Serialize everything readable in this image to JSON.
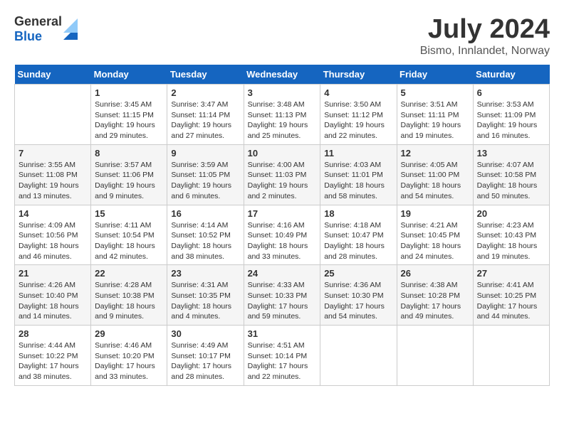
{
  "header": {
    "logo_general": "General",
    "logo_blue": "Blue",
    "month_year": "July 2024",
    "location": "Bismo, Innlandet, Norway"
  },
  "days_of_week": [
    "Sunday",
    "Monday",
    "Tuesday",
    "Wednesday",
    "Thursday",
    "Friday",
    "Saturday"
  ],
  "weeks": [
    [
      {
        "day": "",
        "sunrise": "",
        "sunset": "",
        "daylight": ""
      },
      {
        "day": "1",
        "sunrise": "Sunrise: 3:45 AM",
        "sunset": "Sunset: 11:15 PM",
        "daylight": "Daylight: 19 hours and 29 minutes."
      },
      {
        "day": "2",
        "sunrise": "Sunrise: 3:47 AM",
        "sunset": "Sunset: 11:14 PM",
        "daylight": "Daylight: 19 hours and 27 minutes."
      },
      {
        "day": "3",
        "sunrise": "Sunrise: 3:48 AM",
        "sunset": "Sunset: 11:13 PM",
        "daylight": "Daylight: 19 hours and 25 minutes."
      },
      {
        "day": "4",
        "sunrise": "Sunrise: 3:50 AM",
        "sunset": "Sunset: 11:12 PM",
        "daylight": "Daylight: 19 hours and 22 minutes."
      },
      {
        "day": "5",
        "sunrise": "Sunrise: 3:51 AM",
        "sunset": "Sunset: 11:11 PM",
        "daylight": "Daylight: 19 hours and 19 minutes."
      },
      {
        "day": "6",
        "sunrise": "Sunrise: 3:53 AM",
        "sunset": "Sunset: 11:09 PM",
        "daylight": "Daylight: 19 hours and 16 minutes."
      }
    ],
    [
      {
        "day": "7",
        "sunrise": "Sunrise: 3:55 AM",
        "sunset": "Sunset: 11:08 PM",
        "daylight": "Daylight: 19 hours and 13 minutes."
      },
      {
        "day": "8",
        "sunrise": "Sunrise: 3:57 AM",
        "sunset": "Sunset: 11:06 PM",
        "daylight": "Daylight: 19 hours and 9 minutes."
      },
      {
        "day": "9",
        "sunrise": "Sunrise: 3:59 AM",
        "sunset": "Sunset: 11:05 PM",
        "daylight": "Daylight: 19 hours and 6 minutes."
      },
      {
        "day": "10",
        "sunrise": "Sunrise: 4:00 AM",
        "sunset": "Sunset: 11:03 PM",
        "daylight": "Daylight: 19 hours and 2 minutes."
      },
      {
        "day": "11",
        "sunrise": "Sunrise: 4:03 AM",
        "sunset": "Sunset: 11:01 PM",
        "daylight": "Daylight: 18 hours and 58 minutes."
      },
      {
        "day": "12",
        "sunrise": "Sunrise: 4:05 AM",
        "sunset": "Sunset: 11:00 PM",
        "daylight": "Daylight: 18 hours and 54 minutes."
      },
      {
        "day": "13",
        "sunrise": "Sunrise: 4:07 AM",
        "sunset": "Sunset: 10:58 PM",
        "daylight": "Daylight: 18 hours and 50 minutes."
      }
    ],
    [
      {
        "day": "14",
        "sunrise": "Sunrise: 4:09 AM",
        "sunset": "Sunset: 10:56 PM",
        "daylight": "Daylight: 18 hours and 46 minutes."
      },
      {
        "day": "15",
        "sunrise": "Sunrise: 4:11 AM",
        "sunset": "Sunset: 10:54 PM",
        "daylight": "Daylight: 18 hours and 42 minutes."
      },
      {
        "day": "16",
        "sunrise": "Sunrise: 4:14 AM",
        "sunset": "Sunset: 10:52 PM",
        "daylight": "Daylight: 18 hours and 38 minutes."
      },
      {
        "day": "17",
        "sunrise": "Sunrise: 4:16 AM",
        "sunset": "Sunset: 10:49 PM",
        "daylight": "Daylight: 18 hours and 33 minutes."
      },
      {
        "day": "18",
        "sunrise": "Sunrise: 4:18 AM",
        "sunset": "Sunset: 10:47 PM",
        "daylight": "Daylight: 18 hours and 28 minutes."
      },
      {
        "day": "19",
        "sunrise": "Sunrise: 4:21 AM",
        "sunset": "Sunset: 10:45 PM",
        "daylight": "Daylight: 18 hours and 24 minutes."
      },
      {
        "day": "20",
        "sunrise": "Sunrise: 4:23 AM",
        "sunset": "Sunset: 10:43 PM",
        "daylight": "Daylight: 18 hours and 19 minutes."
      }
    ],
    [
      {
        "day": "21",
        "sunrise": "Sunrise: 4:26 AM",
        "sunset": "Sunset: 10:40 PM",
        "daylight": "Daylight: 18 hours and 14 minutes."
      },
      {
        "day": "22",
        "sunrise": "Sunrise: 4:28 AM",
        "sunset": "Sunset: 10:38 PM",
        "daylight": "Daylight: 18 hours and 9 minutes."
      },
      {
        "day": "23",
        "sunrise": "Sunrise: 4:31 AM",
        "sunset": "Sunset: 10:35 PM",
        "daylight": "Daylight: 18 hours and 4 minutes."
      },
      {
        "day": "24",
        "sunrise": "Sunrise: 4:33 AM",
        "sunset": "Sunset: 10:33 PM",
        "daylight": "Daylight: 17 hours and 59 minutes."
      },
      {
        "day": "25",
        "sunrise": "Sunrise: 4:36 AM",
        "sunset": "Sunset: 10:30 PM",
        "daylight": "Daylight: 17 hours and 54 minutes."
      },
      {
        "day": "26",
        "sunrise": "Sunrise: 4:38 AM",
        "sunset": "Sunset: 10:28 PM",
        "daylight": "Daylight: 17 hours and 49 minutes."
      },
      {
        "day": "27",
        "sunrise": "Sunrise: 4:41 AM",
        "sunset": "Sunset: 10:25 PM",
        "daylight": "Daylight: 17 hours and 44 minutes."
      }
    ],
    [
      {
        "day": "28",
        "sunrise": "Sunrise: 4:44 AM",
        "sunset": "Sunset: 10:22 PM",
        "daylight": "Daylight: 17 hours and 38 minutes."
      },
      {
        "day": "29",
        "sunrise": "Sunrise: 4:46 AM",
        "sunset": "Sunset: 10:20 PM",
        "daylight": "Daylight: 17 hours and 33 minutes."
      },
      {
        "day": "30",
        "sunrise": "Sunrise: 4:49 AM",
        "sunset": "Sunset: 10:17 PM",
        "daylight": "Daylight: 17 hours and 28 minutes."
      },
      {
        "day": "31",
        "sunrise": "Sunrise: 4:51 AM",
        "sunset": "Sunset: 10:14 PM",
        "daylight": "Daylight: 17 hours and 22 minutes."
      },
      {
        "day": "",
        "sunrise": "",
        "sunset": "",
        "daylight": ""
      },
      {
        "day": "",
        "sunrise": "",
        "sunset": "",
        "daylight": ""
      },
      {
        "day": "",
        "sunrise": "",
        "sunset": "",
        "daylight": ""
      }
    ]
  ]
}
